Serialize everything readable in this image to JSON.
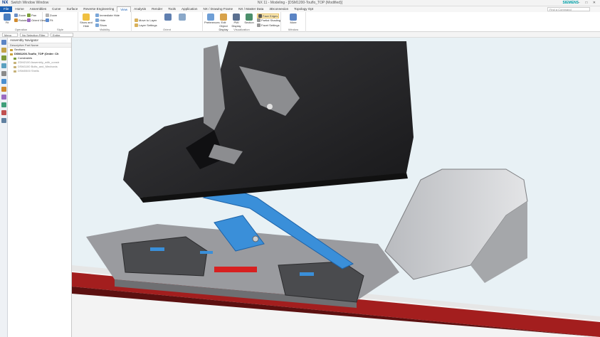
{
  "titlebar": {
    "app_logo": "NX",
    "quick_access": "Switch Window   Window",
    "title": "NX 11 - Modeling - [DSM1200-Touflo_TOP (Modified)]",
    "brand": "SIEMENS",
    "window_controls": "− □ ✕"
  },
  "tabs": [
    "File",
    "Home",
    "Assemblies",
    "Curve",
    "Surface",
    "Reverse Engineering",
    "View",
    "Analysis",
    "Render",
    "Tools",
    "Application",
    "NX / Drawing Frame",
    "NX / Master Data",
    "3Dconnexion",
    "Topology Opt"
  ],
  "active_tab": "View",
  "search_placeholder": "Find a Command",
  "ribbon": {
    "groups": [
      {
        "label": "Operation",
        "buttons": [
          "Fit",
          "Zoom",
          "Rotate",
          "Pan",
          "Orient View"
        ]
      },
      {
        "label": "Style",
        "buttons": [
          "Zoom",
          "Fit"
        ]
      },
      {
        "label": "Visibility",
        "buttons": [
          "Show and Hide",
          "Immediate Hide",
          "Hide",
          "Show"
        ]
      },
      {
        "label": "Orient",
        "buttons": [
          "Move to Layer",
          "Layer Settings"
        ]
      },
      {
        "label": "Visualization",
        "buttons": [
          "Preferences",
          "Edit Object Display",
          "PMI Display",
          "Section",
          "Hide Faces",
          "Face Edges",
          "Partial Shading",
          "Facet Settings"
        ]
      },
      {
        "label": "Window",
        "buttons": [
          "More"
        ]
      }
    ]
  },
  "selection": {
    "menu": "Menu",
    "filter": "No Selection Filter",
    "scope": "Entire Assembly"
  },
  "navigator": {
    "title": "Assembly Navigator",
    "column": "Descriptive Part Name",
    "rows": [
      {
        "label": "Sections",
        "color": "#caa23a"
      },
      {
        "label": "DSM1200-Touflo_TOP (Order: Ch",
        "color": "#caa23a"
      },
      {
        "label": "Constraints",
        "color": "#7c9a3a"
      },
      {
        "label": "ZDM2100 Assembly_with_constr",
        "color": "#c7b27a"
      },
      {
        "label": "DSM1100 Bolts_and_Mechanis",
        "color": "#c7b27a"
      },
      {
        "label": "DSM0500 Shells",
        "color": "#c7b27a"
      }
    ]
  },
  "colors": {
    "ribbon_blue": "#1a5fb4",
    "viewport_bg": "#e8f1f5",
    "boot_black": "#2a2a2c",
    "binding_gray": "#8d8f93",
    "linkage_blue": "#3a8fd9",
    "ski_red": "#a31e1e"
  }
}
